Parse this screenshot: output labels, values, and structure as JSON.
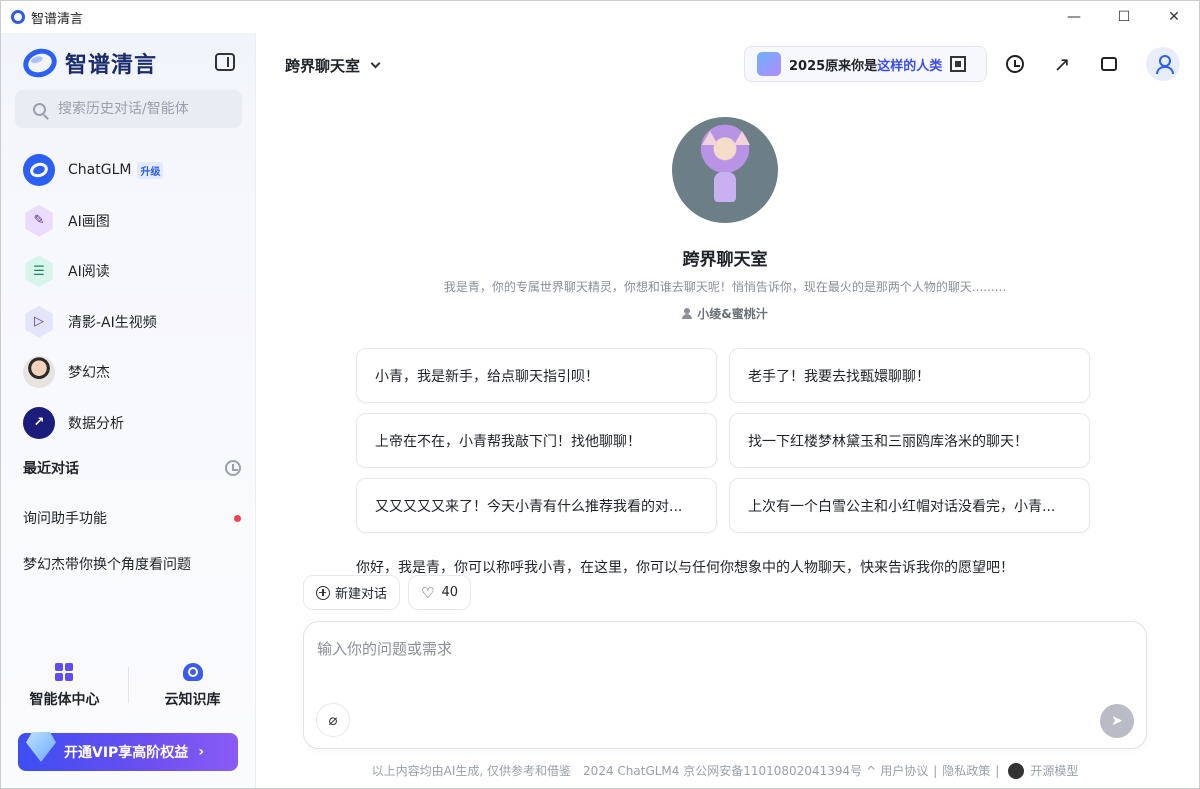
{
  "window": {
    "title": "智谱清言",
    "controls": {
      "minimize": "—",
      "maximize": "☐",
      "close": "✕"
    }
  },
  "sidebar": {
    "brand": "智谱清言",
    "search_placeholder": "搜索历史对话/智能体",
    "nav": [
      {
        "label": "ChatGLM",
        "badge": "升级",
        "icon": "chatglm-logo-icon"
      },
      {
        "label": "AI画图",
        "icon": "ai-draw-icon"
      },
      {
        "label": "AI阅读",
        "icon": "ai-read-icon"
      },
      {
        "label": "清影-AI生视频",
        "icon": "video-play-icon"
      },
      {
        "label": "梦幻杰",
        "icon": "user-avatar-icon"
      },
      {
        "label": "数据分析",
        "icon": "chart-icon"
      }
    ],
    "recent_title": "最近对话",
    "recent": [
      {
        "label": "询问助手功能",
        "unread": true
      },
      {
        "label": "梦幻杰带你换个角度看问题",
        "unread": false
      }
    ],
    "tools": [
      {
        "label": "智能体中心",
        "icon": "grid-icon"
      },
      {
        "label": "云知识库",
        "icon": "cloud-icon"
      }
    ],
    "vip": {
      "label": "开通VIP享高阶权益",
      "arrow": "›"
    }
  },
  "header": {
    "room_name": "跨界聊天室",
    "promo_prefix": "2025原来你是",
    "promo_highlight": "这样的人类"
  },
  "agent": {
    "name": "跨界聊天室",
    "description": "我是青，你的专属世界聊天精灵，你想和谁去聊天呢！悄悄告诉你，现在最火的是那两个人物的聊天.........",
    "author": "小绫&蜜桃汁"
  },
  "suggestions": [
    "小青，我是新手，给点聊天指引呗！",
    "老手了！我要去找甄嬛聊聊！",
    "上帝在不在，小青帮我敲下门！找他聊聊！",
    "找一下红楼梦林黛玉和三丽鸥库洛米的聊天！",
    "又又又又又来了！今天小青有什么推荐我看的对...",
    "上次有一个白雪公主和小红帽对话没看完，小青..."
  ],
  "greeting": "你好，我是青，你可以称呼我小青，在这里，你可以与任何你想象中的人物聊天，快来告诉我你的愿望吧！",
  "actions": {
    "new_chat": "新建对话",
    "likes": "40"
  },
  "composer": {
    "placeholder": "输入你的问题或需求"
  },
  "footer": {
    "disclaimer": "以上内容均由AI生成, 仅供参考和借鉴",
    "license": "2024 ChatGLM4 京公网安备11010802041394号",
    "caret": "^",
    "user_agreement": "用户协议",
    "privacy": "隐私政策",
    "open_source": "开源模型",
    "sep": "|"
  }
}
